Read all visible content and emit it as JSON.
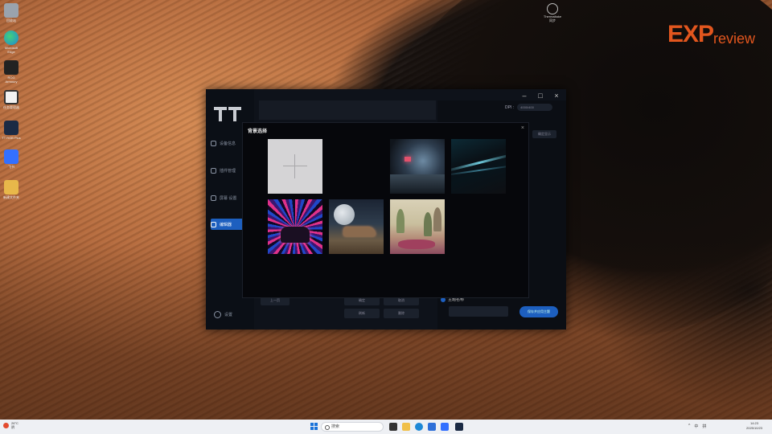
{
  "desktop": {
    "icons": [
      {
        "label": "回收站",
        "color": "#9aa3ad"
      },
      {
        "label": "Microsoft Edge",
        "color": "#1e88d6"
      },
      {
        "label": "ROG Armoury",
        "color": "#222222"
      },
      {
        "label": "任务管理器",
        "color": "#f2f2f2"
      },
      {
        "label": "TT RGB Plus",
        "color": "#1b2a44"
      },
      {
        "label": "飞书",
        "color": "#3370ff"
      },
      {
        "label": "新建文件夹",
        "color": "#e8b84a"
      }
    ],
    "top_icon_label": "Thermaltake 同步",
    "watermark": {
      "main": "EXP",
      "sub": "review"
    }
  },
  "app": {
    "dpi_label": "DPI :",
    "dpi_value": "4000/400",
    "nav": [
      {
        "label": "设备信息",
        "icon": "info-icon",
        "active": false
      },
      {
        "label": "插件管理",
        "icon": "plugin-icon",
        "active": false
      },
      {
        "label": "屏幕 设置",
        "icon": "monitor-icon",
        "active": false
      },
      {
        "label": "编辑器",
        "icon": "edit-icon",
        "active": true
      }
    ],
    "settings_label": "设置",
    "right_top_button": "确定显示",
    "buttons": [
      {
        "label": "上一页"
      },
      {
        "label": "确定"
      },
      {
        "label": "取消"
      },
      {
        "label": "刷新"
      },
      {
        "label": "删除"
      }
    ],
    "theme_label": "主题名称",
    "save_button": "保存并应用主题"
  },
  "dialog": {
    "title": "背景选择",
    "close": "×",
    "add_tile": "plus-icon",
    "tiles": [
      {
        "name": "empty"
      },
      {
        "name": "city-night"
      },
      {
        "name": "dark-light-streaks"
      },
      {
        "name": "neon-tunnel-car"
      },
      {
        "name": "moon-airship"
      },
      {
        "name": "fantasy-landscape"
      }
    ]
  },
  "taskbar": {
    "weather_temp": "26°C",
    "weather_desc": "阴",
    "search_placeholder": "搜索",
    "tray": [
      "^",
      "中",
      "拼"
    ],
    "time": "14:23",
    "date": "2025/10/23"
  },
  "colors": {
    "accent": "#1d5fbf",
    "dialog_bg": "#06070b",
    "watermark": "#e2561e"
  }
}
